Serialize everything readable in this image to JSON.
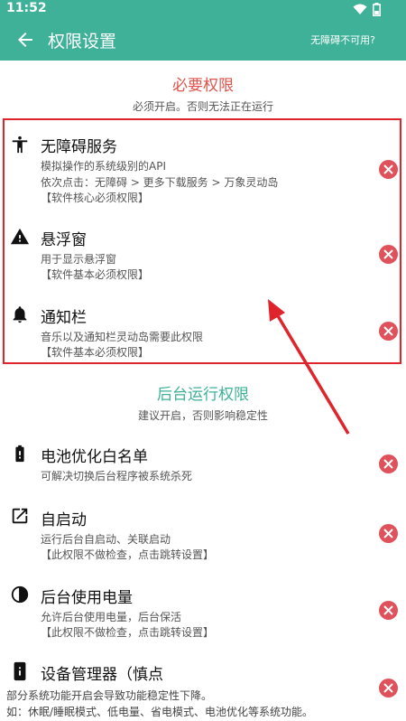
{
  "status": {
    "time": "11:52"
  },
  "toolbar": {
    "title": "权限设置",
    "help": "无障碍不可用?"
  },
  "required": {
    "title": "必要权限",
    "subtitle": "必须开启。否则无法正在运行",
    "title_color": "#e0524b",
    "items": [
      {
        "icon": "accessibility-icon",
        "name": "无障碍服务",
        "lines": [
          "模拟操作的系统级别的API",
          "依次点击：无障碍 > 更多下载服务 > 万象灵动岛",
          "【软件核心必须权限】"
        ]
      },
      {
        "icon": "warning-icon",
        "name": "悬浮窗",
        "lines": [
          "用于显示悬浮窗",
          "【软件基本必须权限】"
        ]
      },
      {
        "icon": "bell-icon",
        "name": "通知栏",
        "lines": [
          "音乐以及通知栏灵动岛需要此权限",
          "【软件基本必须权限】"
        ]
      }
    ]
  },
  "background": {
    "title": "后台运行权限",
    "subtitle": "建议开启，否则影响稳定性",
    "title_color": "#3eb198",
    "items": [
      {
        "icon": "battery-icon",
        "name": "电池优化白名单",
        "lines": [
          "可解决切换后台程序被系统杀死"
        ]
      },
      {
        "icon": "open-external-icon",
        "name": "自启动",
        "lines": [
          "运行后台自启动、关联启动",
          "【此权限不做检查，点击跳转设置】"
        ]
      },
      {
        "icon": "contrast-icon",
        "name": "后台使用电量",
        "lines": [
          "允许后台使用电量，后台保活",
          "【此权限不做检查，点击跳转设置】"
        ]
      },
      {
        "icon": "device-info-icon",
        "name": "设备管理器（慎点",
        "lines": []
      }
    ]
  },
  "footer": {
    "line1": "部分系统功能开启会导致功能稳定性下降。",
    "line2": "如：休眠/睡眠模式、低电量、省电模式、电池优化等系统功能。"
  },
  "colors": {
    "primary": "#3eb198",
    "danger": "#e0525b",
    "highlight": "#e0242c"
  }
}
